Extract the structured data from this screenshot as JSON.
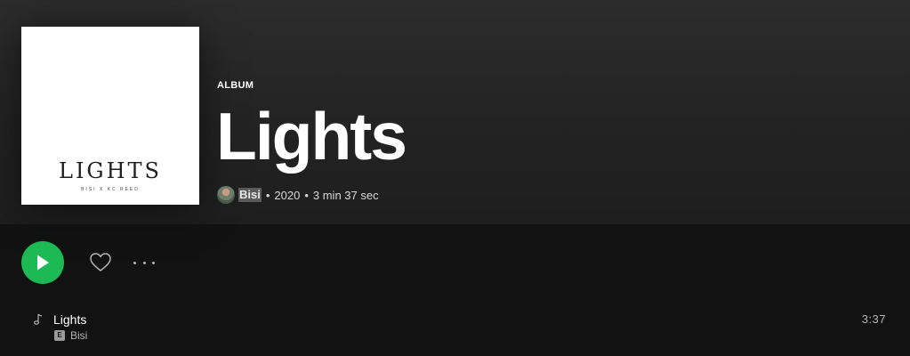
{
  "album": {
    "type_label": "ALBUM",
    "title": "Lights",
    "cover_title": "LIGHTS",
    "cover_subtitle": "BISI X KC REED",
    "artist": "Bisi",
    "separator": "•",
    "year": "2020",
    "duration": "3 min 37 sec"
  },
  "actions": {
    "play_icon": "play-icon",
    "like_icon": "heart-icon",
    "more_icon": "more-icon",
    "accent_color": "#1db954"
  },
  "tracks": [
    {
      "title": "Lights",
      "explicit_badge": "E",
      "artist": "Bisi",
      "duration": "3:37",
      "icon": "music-note-icon"
    }
  ]
}
